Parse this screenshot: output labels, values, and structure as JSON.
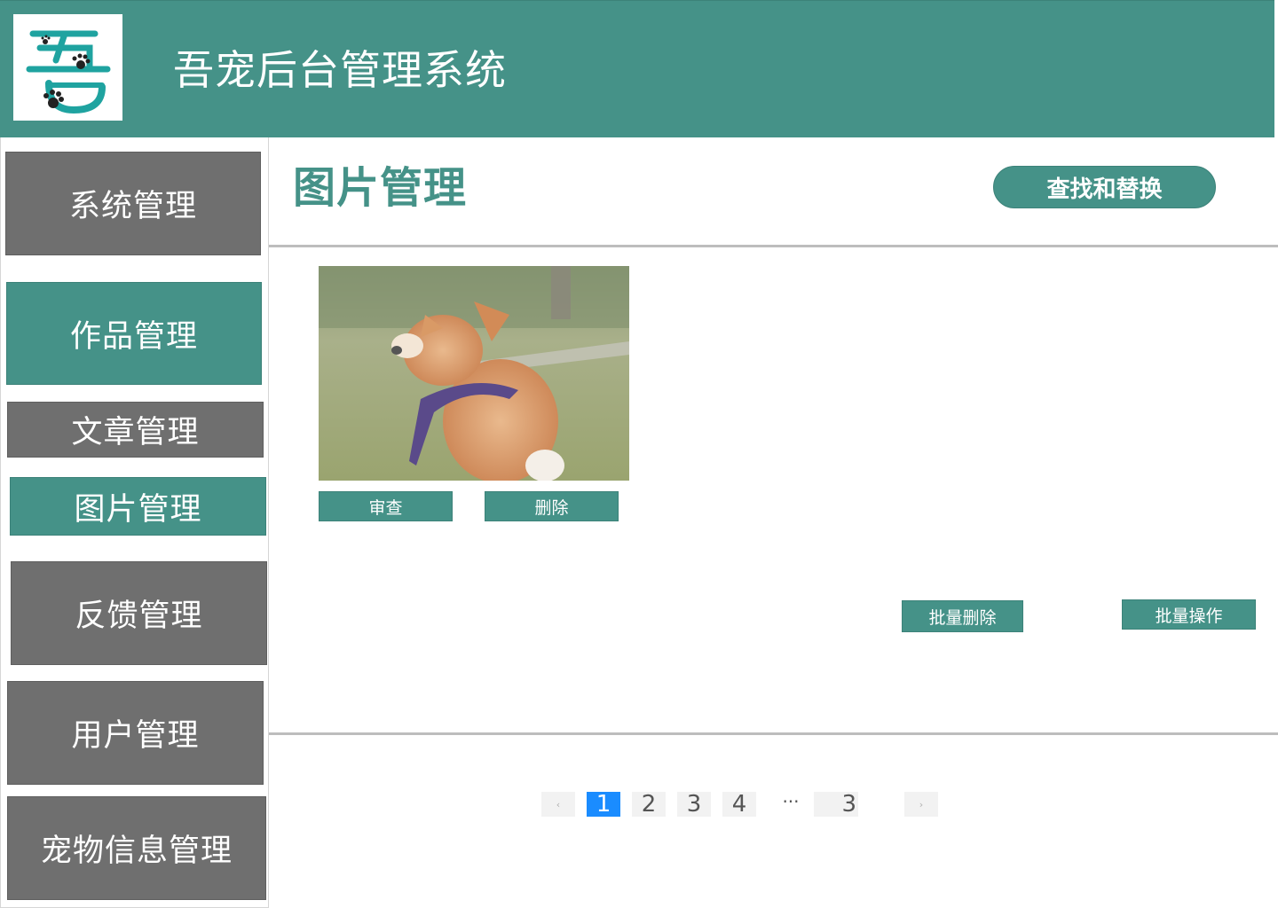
{
  "header": {
    "app_title": "吾宠后台管理系统",
    "logo_icon": "paw-logo-icon"
  },
  "sidebar": {
    "items": [
      {
        "label": "系统管理",
        "style": "gray"
      },
      {
        "label": "作品管理",
        "style": "green"
      },
      {
        "label": "文章管理",
        "style": "gray"
      },
      {
        "label": "图片管理",
        "style": "green"
      },
      {
        "label": "反馈管理",
        "style": "gray"
      },
      {
        "label": "用户管理",
        "style": "gray"
      },
      {
        "label": "宠物信息管理",
        "style": "gray"
      }
    ]
  },
  "main": {
    "title": "图片管理",
    "find_replace_label": "查找和替换",
    "image_card": {
      "review_label": "审查",
      "delete_label": "删除"
    },
    "batch_delete_label": "批量删除",
    "batch_operate_label": "批量操作"
  },
  "pagination": {
    "prev": "‹",
    "pages": [
      "1",
      "2",
      "3",
      "4"
    ],
    "current": "1",
    "ellipsis": "···",
    "last": "3",
    "next": "›"
  },
  "colors": {
    "brand_green": "#459288",
    "nav_gray": "#6f6f6f",
    "pager_active": "#1a8cff"
  }
}
